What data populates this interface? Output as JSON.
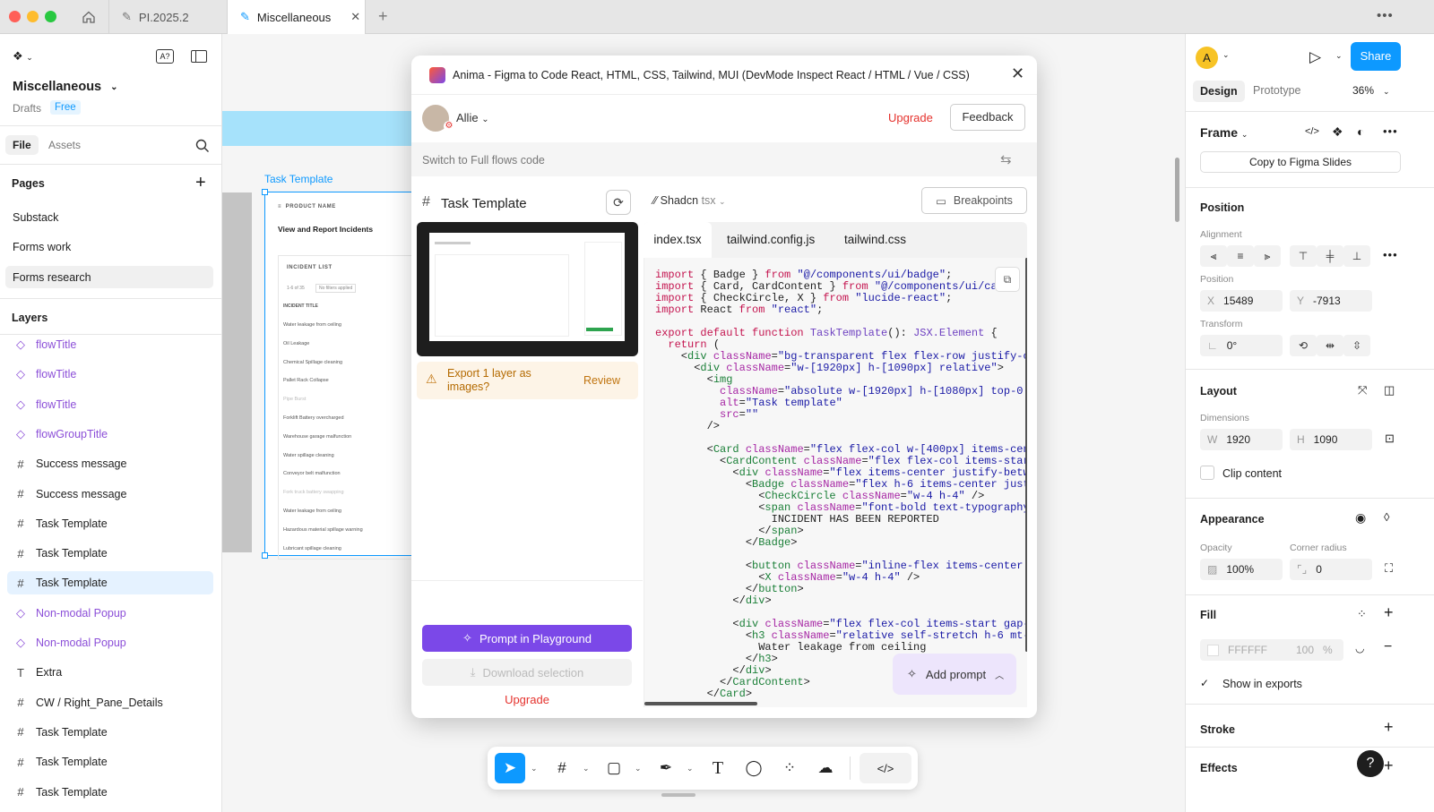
{
  "tabs": [
    {
      "label": "PI.2025.2"
    },
    {
      "label": "Miscellaneous"
    }
  ],
  "left": {
    "file_name": "Miscellaneous",
    "drafts": "Drafts",
    "plan": "Free",
    "tab_file": "File",
    "tab_assets": "Assets",
    "pages_title": "Pages",
    "pages": [
      "Substack",
      "Forms work",
      "Forms research"
    ],
    "layers_title": "Layers",
    "layers": [
      {
        "label": "flowTitle",
        "icon": "component-instance"
      },
      {
        "label": "flowTitle",
        "icon": "component-instance"
      },
      {
        "label": "flowTitle",
        "icon": "component-instance"
      },
      {
        "label": "flowGroupTitle",
        "icon": "component-instance"
      },
      {
        "label": "Success message",
        "icon": "frame"
      },
      {
        "label": "Success message",
        "icon": "frame"
      },
      {
        "label": "Task Template",
        "icon": "frame"
      },
      {
        "label": "Task Template",
        "icon": "frame"
      },
      {
        "label": "Task Template",
        "icon": "frame"
      },
      {
        "label": "Non-modal Popup",
        "icon": "component-instance"
      },
      {
        "label": "Non-modal Popup",
        "icon": "component-instance"
      },
      {
        "label": "Extra",
        "icon": "text"
      },
      {
        "label": "CW / Right_Pane_Details",
        "icon": "frame"
      },
      {
        "label": "Task Template",
        "icon": "frame"
      },
      {
        "label": "Task Template",
        "icon": "frame"
      },
      {
        "label": "Task Template",
        "icon": "frame"
      }
    ]
  },
  "canvas": {
    "frame_label": "Task Template",
    "product_name": "PRODUCT NAME",
    "page_title": "View and Report Incidents",
    "list_title": "INCIDENT LIST",
    "count": "1-6 of 35",
    "filters": "No filters applied",
    "col": "INCIDENT TITLE",
    "rows": [
      "Water leakage from ceiling",
      "Oil Leakage",
      "Chemical Spillage cleaning",
      "Pallet Rack Collapse",
      "Pipe Burst",
      "Forklift Battery overcharged",
      "Warehouse garage malfunction",
      "Water spillage cleaning",
      "Conveyor belt malfunction",
      "Fork truck battery swapping",
      "Water leakage from ceiling",
      "Hazardous material spillage warning",
      "Lubricant spillage cleaning"
    ]
  },
  "dialog": {
    "title": "Anima - Figma to Code React, HTML, CSS, Tailwind, MUI (DevMode Inspect React / HTML / Vue / CSS)",
    "user": "Allie",
    "upgrade": "Upgrade",
    "feedback": "Feedback",
    "switch_text": "Switch to Full flows code",
    "frame_name": "Task Template",
    "framework": "Shadcn",
    "lang": "tsx",
    "breakpoints": "Breakpoints",
    "export_text": "Export 1 layer as images?",
    "review": "Review",
    "prompt_btn": "Prompt in Playground",
    "download_btn": "Download selection",
    "upgrade_link": "Upgrade",
    "files": [
      "index.tsx",
      "tailwind.config.js",
      "tailwind.css"
    ],
    "add_prompt": "Add prompt"
  },
  "right": {
    "avatar": "A",
    "share": "Share",
    "tab_design": "Design",
    "tab_prototype": "Prototype",
    "zoom": "36%",
    "frame": "Frame",
    "copy_slides": "Copy to Figma Slides",
    "position": "Position",
    "alignment": "Alignment",
    "position_label": "Position",
    "x_key": "X",
    "x": "15489",
    "y_key": "Y",
    "y": "-7913",
    "transform": "Transform",
    "rotation": "0°",
    "layout": "Layout",
    "dimensions": "Dimensions",
    "w_key": "W",
    "w": "1920",
    "h_key": "H",
    "h": "1090",
    "clip": "Clip content",
    "appearance": "Appearance",
    "opacity_label": "Opacity",
    "radius_label": "Corner radius",
    "opacity": "100%",
    "radius": "0",
    "fill": "Fill",
    "fill_hex": "FFFFFF",
    "fill_opacity": "100",
    "fill_pct": "%",
    "show_exports": "Show in exports",
    "stroke": "Stroke",
    "effects": "Effects"
  },
  "colors": {
    "accent": "#0d99ff",
    "anima": "#7b48e8",
    "upgrade": "#e5322d",
    "canvas_band": "#a6e2fb"
  }
}
